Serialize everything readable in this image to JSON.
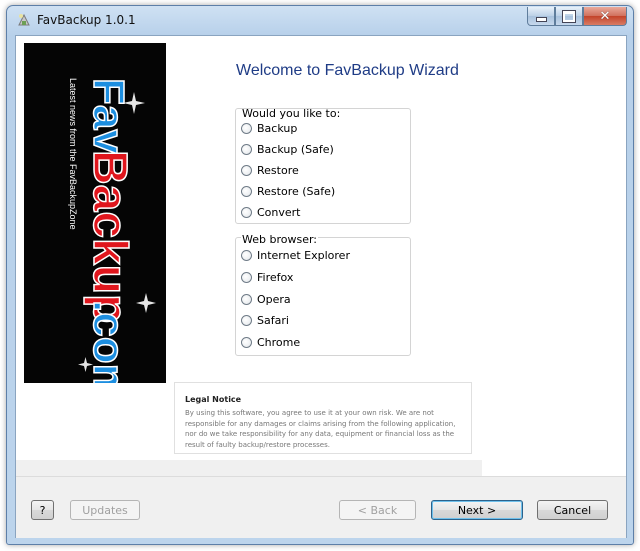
{
  "window": {
    "title": "FavBackup 1.0.1"
  },
  "banner": {
    "logo_text": "FavBackup.com",
    "tagline": "Latest news from the FavBackupZone"
  },
  "wizard": {
    "heading": "Welcome to FavBackup Wizard",
    "action_group": {
      "label": "Would you like to:",
      "options": [
        "Backup",
        "Backup (Safe)",
        "Restore",
        "Restore (Safe)",
        "Convert"
      ]
    },
    "browser_group": {
      "label": "Web browser:",
      "options": [
        "Internet Explorer",
        "Firefox",
        "Opera",
        "Safari",
        "Chrome"
      ]
    }
  },
  "legal": {
    "title": "Legal Notice",
    "text": "By using this software, you agree to use it at your own risk. We are not responsible for any damages or claims arising from the following application, nor do we take responsibility for any data, equipment or financial loss as the result of faulty backup/restore processes."
  },
  "buttons": {
    "help": "?",
    "updates": "Updates",
    "back": "< Back",
    "next": "Next >",
    "cancel": "Cancel"
  }
}
